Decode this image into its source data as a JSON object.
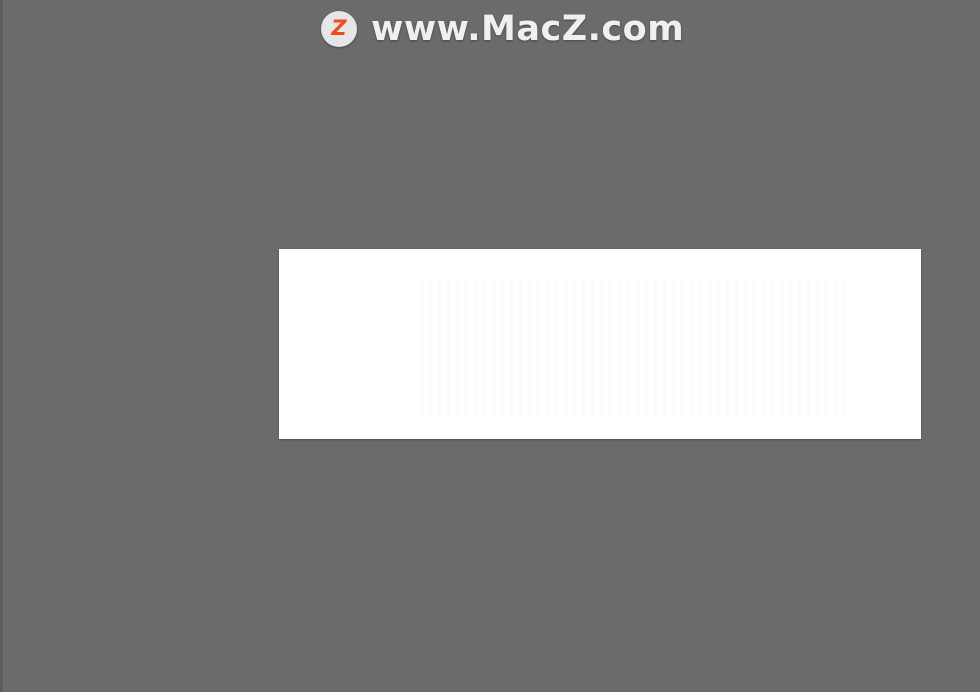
{
  "watermark": {
    "icon": "macz-z-logo-icon",
    "logo_letter": "Z",
    "logo_color": "#f04a1e",
    "text": "www.MacZ.com"
  },
  "colors": {
    "background": "#6b6b6b",
    "panel": "#ffffff"
  }
}
